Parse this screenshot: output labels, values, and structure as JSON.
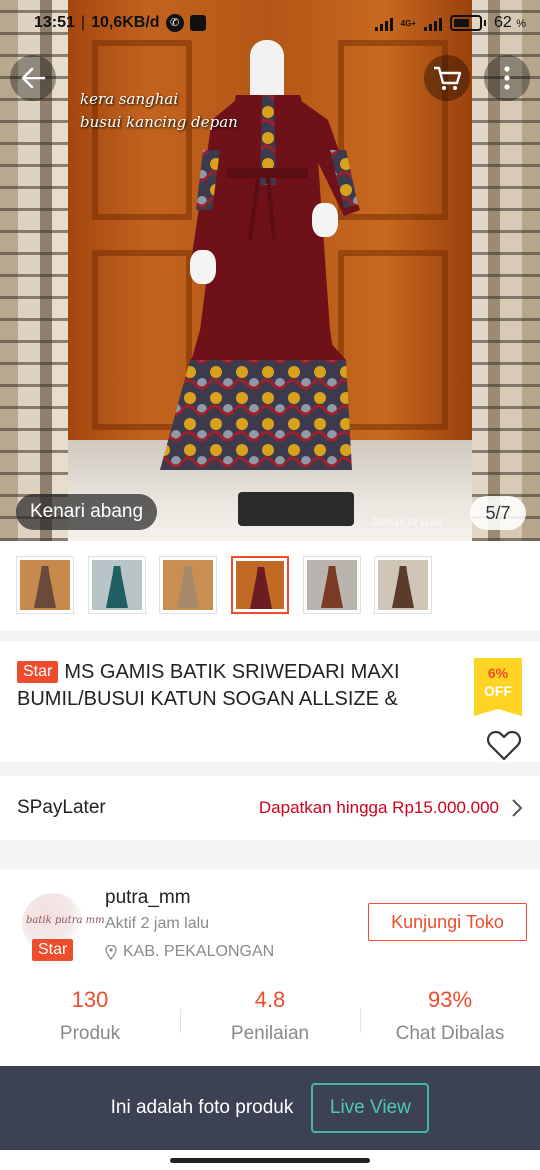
{
  "status_bar": {
    "time": "13:51",
    "net_speed": "10,6KB/d",
    "network_type": "4G+",
    "battery_percent": "62",
    "percent_sign": "%",
    "battery_level": 0.62
  },
  "top_nav": {
    "back_icon": "arrow-left-icon",
    "cart_icon": "cart-icon",
    "more_icon": "more-vertical-icon"
  },
  "hero": {
    "watermark_line1": "kera sanghai",
    "watermark_line2": "busui kancing depan",
    "model_label": "Kenari abang",
    "image_counter": "5/7",
    "photo_date": "2020.10.19 11:46"
  },
  "thumbnails": {
    "count": 6,
    "active_index": 3,
    "colors": [
      "#6a4b3b",
      "#1f5e63",
      "#a8886a",
      "#6b1b22",
      "#7a3a26",
      "#5b3b2b"
    ]
  },
  "product": {
    "badge": "Star",
    "title": "MS GAMIS BATIK SRIWEDARI MAXI BUMIL/BUSUI KATUN SOGAN ALLSIZE &",
    "discount_pct": "6%",
    "discount_off": "OFF",
    "favorite_icon": "heart-outline-icon"
  },
  "paylater": {
    "label": "SPayLater",
    "promo": "Dapatkan hingga Rp15.000.000",
    "chevron_icon": "chevron-right-icon"
  },
  "shop": {
    "logo_text": "batik putra mm",
    "badge": "Star",
    "name": "putra_mm",
    "active": "Aktif 2 jam lalu",
    "location_icon": "location-pin-icon",
    "location": "KAB. PEKALONGAN",
    "visit_button": "Kunjungi Toko",
    "stats": [
      {
        "value": "130",
        "label": "Produk"
      },
      {
        "value": "4.8",
        "label": "Penilaian"
      },
      {
        "value": "93%",
        "label": "Chat Dibalas"
      }
    ]
  },
  "bottom_bar": {
    "text": "Ini adalah foto produk",
    "live_button": "Live View"
  },
  "colors": {
    "accent": "#ee4d2d",
    "promo_red": "#d0011b",
    "bottom_bar": "#3c4153",
    "live_teal": "#3fb8a4",
    "discount_yellow": "#ffd424"
  }
}
